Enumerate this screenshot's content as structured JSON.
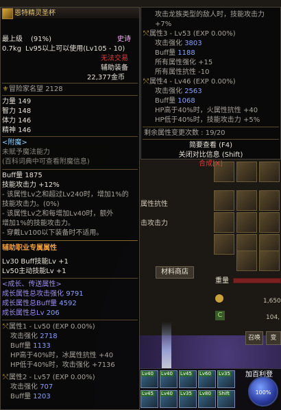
{
  "background": {
    "label_guild_attr": "属性抗性",
    "label_attack": "击攻击力",
    "shop_button": "材料商店",
    "weight_label": "重量",
    "gold_1": "1,650",
    "gold_2": "104,",
    "summon_button": "召唤",
    "transform_button": "变",
    "player_name": "加百利登",
    "orb_percent": "100%",
    "skill_levels": [
      "Lv40",
      "Lv40",
      "Lv45",
      "Lv60",
      "Lv35",
      "Lv70",
      "Lv75",
      "Lv70",
      "Lv45",
      "Lv40",
      "Lv35",
      "Lv80",
      "Lv35",
      "Lv40",
      "Lv60",
      "Shift"
    ]
  },
  "tooltip_left": {
    "item_name": "恩特精灵圣杯",
    "level": "最上级",
    "quality": "(91%)",
    "rarity": "史诗",
    "weight": "0.7kg",
    "level_req": "Lv95以上可以使用(Lv105 - 10)",
    "untradeable": "无法交易",
    "category": "辅助装备",
    "price": "22,377金币",
    "fame_label": "冒险家名望",
    "fame_value": "2128",
    "stats": [
      {
        "name": "力量",
        "value": "149"
      },
      {
        "name": "智力",
        "value": "148"
      },
      {
        "name": "体力",
        "value": "146"
      },
      {
        "name": "精神",
        "value": "146"
      }
    ],
    "enchant_header": "<附魔>",
    "enchant_none": "未赋予魔法能力",
    "enchant_hint": "(百科词典中可查看附魔信息)",
    "buff_line": "Buff量 1875",
    "skill_atk": "技能攻击力 +12%",
    "desc_lines": [
      "- 该属性Lv之和超过Lv240时，增加1%的",
      "技能攻击力。(0%)",
      "- 该属性Lv之和每增加Lv40时，额外",
      "增加1%的技能攻击力。",
      "- 穿戴Lv100以下装备时不适用。"
    ],
    "aux_header": "辅助职业专属属性",
    "aux_lines": [
      "Lv30 Buff技能Lv +1",
      "Lv50主动技能Lv +1"
    ],
    "growth_header": "<成长、传送属性>",
    "growth_lines": [
      {
        "text": "成长属性总攻击强化",
        "value": "9791"
      },
      {
        "text": "成长属性总Buff量",
        "value": "4592"
      },
      {
        "text": "成长属性总Lv",
        "value": "206"
      }
    ],
    "attr1_header": "属性1 - Lv50 (EXP 0.00%)",
    "attr1_lines": [
      {
        "text": "攻击强化",
        "value": "2718"
      },
      {
        "text": "Buff量",
        "value": "1133"
      },
      {
        "text": "HP高于40%时，冰属性抗性 +40",
        "value": ""
      },
      {
        "text": "HP低于40%时，攻击强化 +7136",
        "value": ""
      }
    ],
    "attr2_header": "属性2 - Lv57 (EXP 0.00%)",
    "attr2_lines": [
      {
        "text": "攻击强化",
        "value": "707"
      },
      {
        "text": "Buff量",
        "value": "1203"
      }
    ]
  },
  "tooltip_right": {
    "top_line1": "攻击龙族类型的敌人时，技能攻击力",
    "top_line2": "+7%",
    "attr3_header": "属性3 - Lv53 (EXP 0.00%)",
    "attr3_lines": [
      {
        "text": "攻击强化",
        "value": "3803"
      },
      {
        "text": "Buff量",
        "value": "1188"
      },
      {
        "text": "所有属性强化 +15",
        "value": ""
      },
      {
        "text": "所有属性抗性 -10",
        "value": ""
      }
    ],
    "attr4_header": "属性4 - Lv46 (EXP 0.00%)",
    "attr4_lines": [
      {
        "text": "攻击强化",
        "value": "2563"
      },
      {
        "text": "Buff量",
        "value": "1068"
      },
      {
        "text": "HP高于40%时，火属性抗性 +40",
        "value": ""
      },
      {
        "text": "HP低于40%时，技能攻击力 +5%",
        "value": ""
      }
    ],
    "remaining": "剩余属性变更次数 : 19/20",
    "brief_view": "简要查看 (F4)",
    "close_compare": "关闭对比信息 (Shift)",
    "combine": "合成[X]"
  }
}
